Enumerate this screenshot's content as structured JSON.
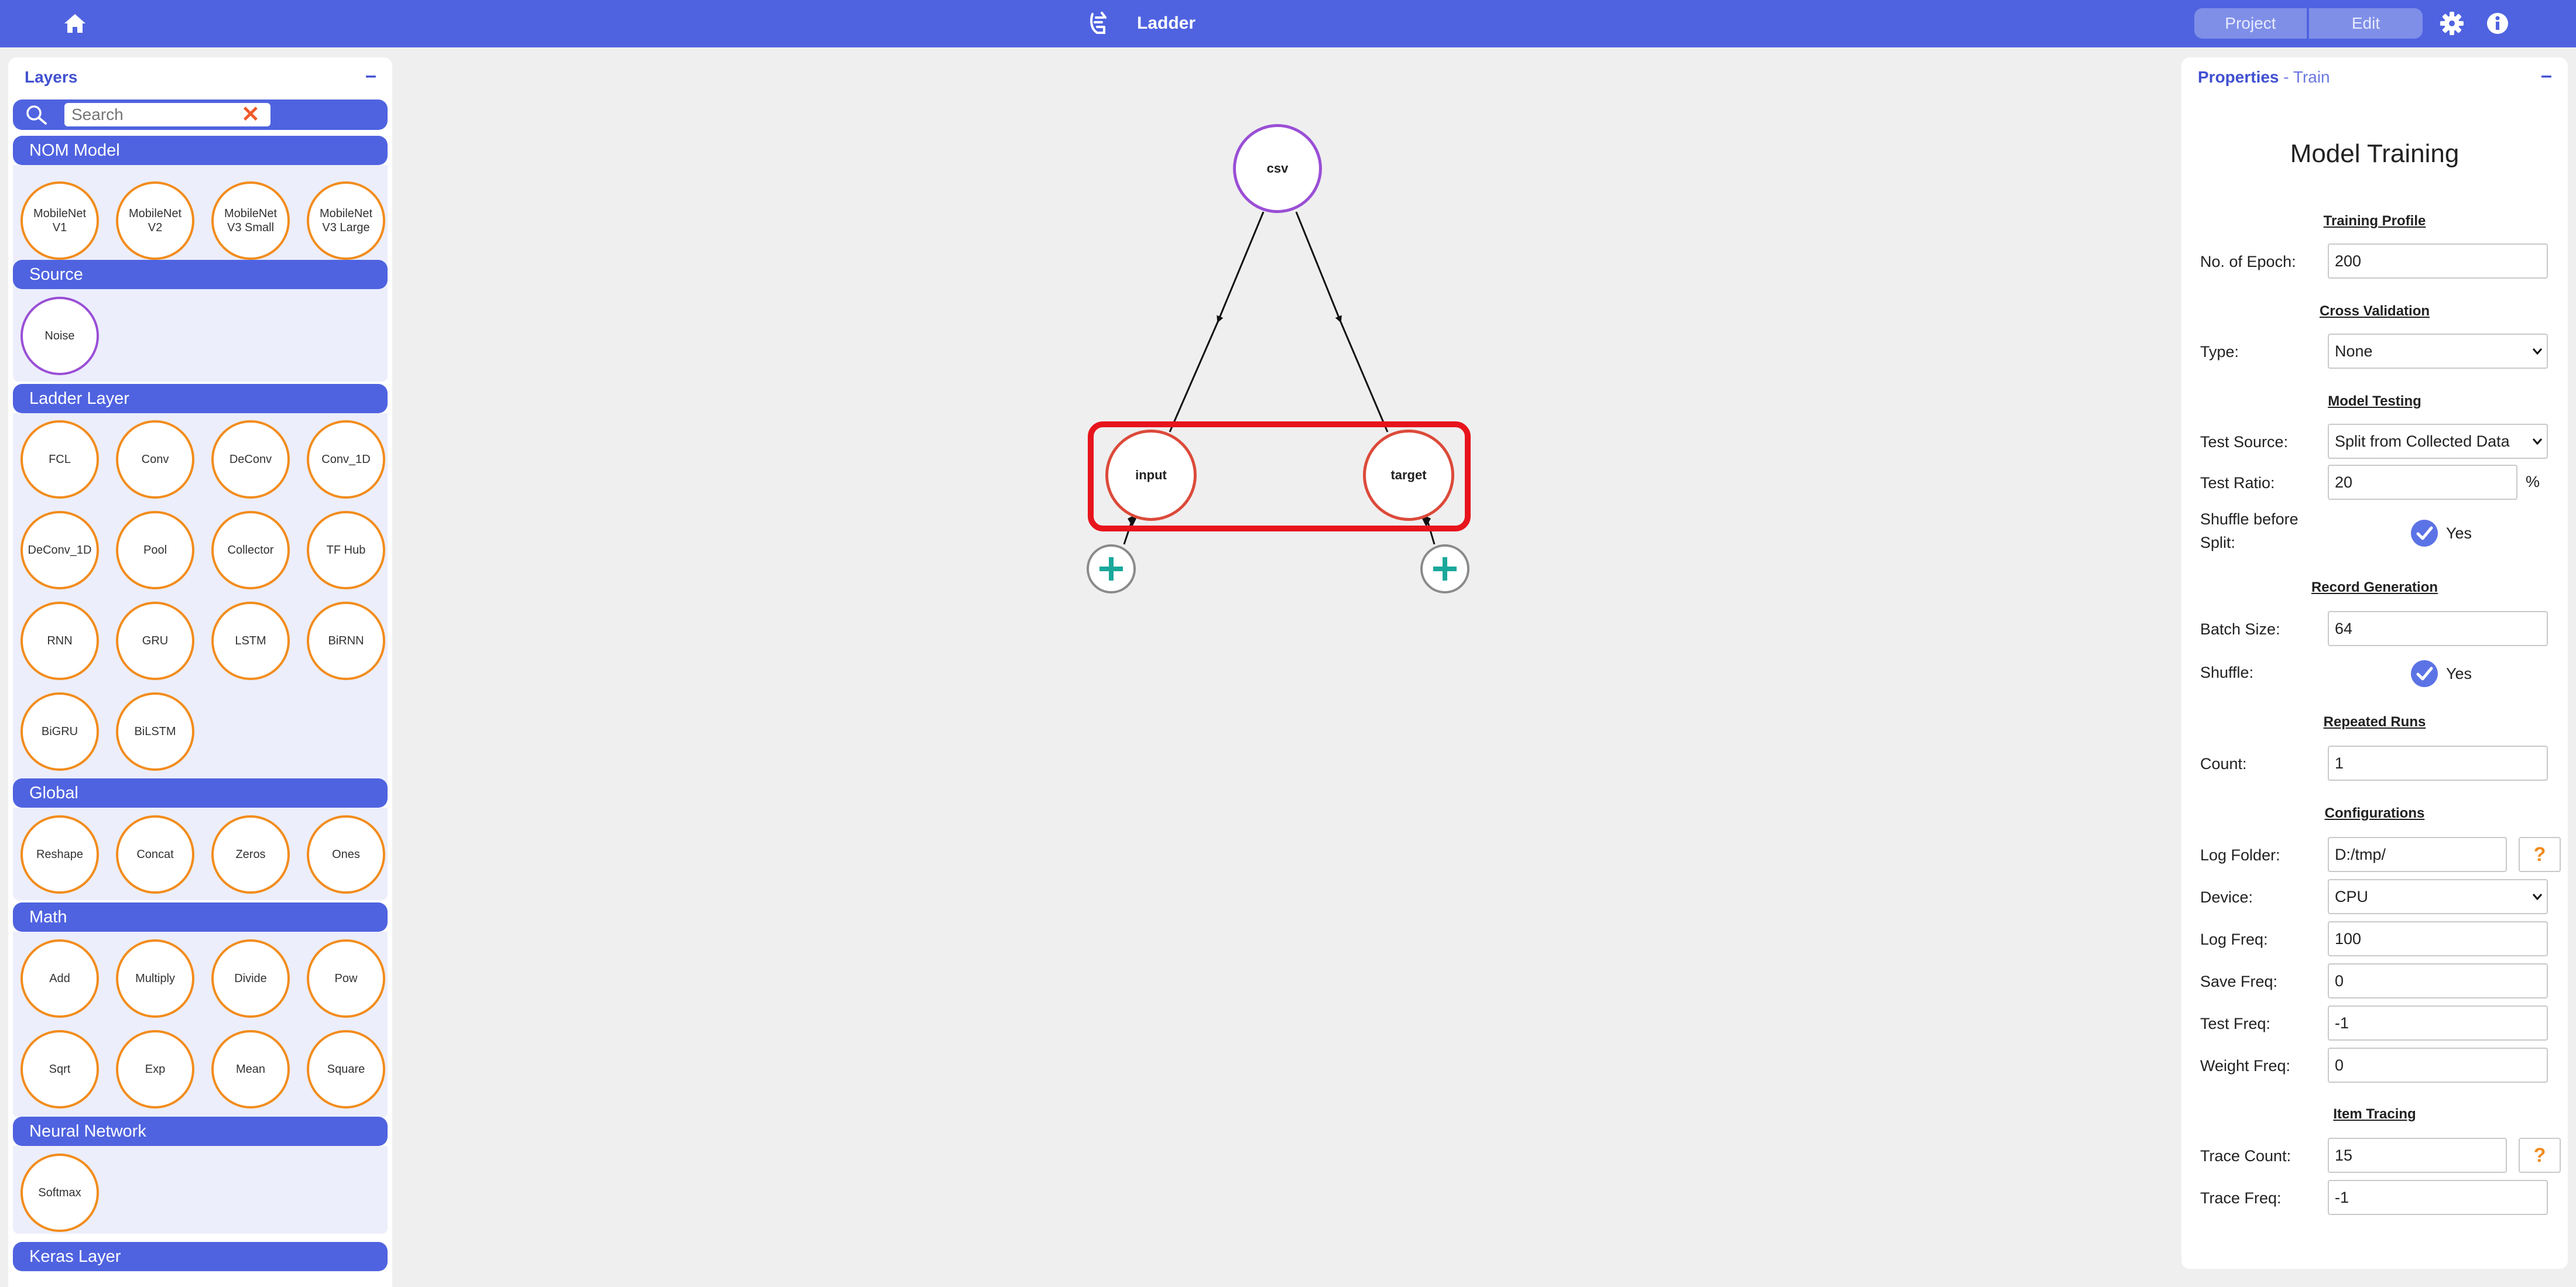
{
  "topbar": {
    "title": "Ladder",
    "project_label": "Project",
    "edit_label": "Edit"
  },
  "layers_panel": {
    "title": "Layers",
    "collapse": "–",
    "search": {
      "placeholder": "Search",
      "value": ""
    },
    "clear": "✕",
    "categories": [
      {
        "name": "NOM Model",
        "items": [
          "MobileNet V1",
          "MobileNet V2",
          "MobileNet V3 Small",
          "MobileNet V3 Large"
        ]
      },
      {
        "name": "Source",
        "items": [
          "Noise"
        ]
      },
      {
        "name": "Ladder Layer",
        "items": [
          "FCL",
          "Conv",
          "DeConv",
          "Conv_1D",
          "DeConv_1D",
          "Pool",
          "Collector",
          "TF Hub",
          "RNN",
          "GRU",
          "LSTM",
          "BiRNN",
          "BiGRU",
          "BiLSTM"
        ]
      },
      {
        "name": "Global",
        "items": [
          "Reshape",
          "Concat",
          "Zeros",
          "Ones"
        ]
      },
      {
        "name": "Math",
        "items": [
          "Add",
          "Multiply",
          "Divide",
          "Pow",
          "Sqrt",
          "Exp",
          "Mean",
          "Square"
        ]
      },
      {
        "name": "Neural Network",
        "items": [
          "Softmax"
        ]
      },
      {
        "name": "Keras Layer",
        "items": []
      }
    ]
  },
  "graph": {
    "nodes": {
      "csv": "csv",
      "input": "input",
      "target": "target"
    }
  },
  "properties": {
    "title": "Properties",
    "subtitle": " - Train",
    "collapse": "–",
    "heading": "Model Training",
    "sections": {
      "training_profile": "Training Profile",
      "cross_validation": "Cross Validation",
      "model_testing": "Model Testing",
      "record_generation": "Record Generation",
      "repeated_runs": "Repeated Runs",
      "configurations": "Configurations",
      "item_tracing": "Item Tracing"
    },
    "fields": {
      "epoch": {
        "label": "No. of Epoch:",
        "value": "200"
      },
      "cv_type": {
        "label": "Type:",
        "value": "None"
      },
      "test_source": {
        "label": "Test Source:",
        "value": "Split from Collected Data"
      },
      "test_ratio": {
        "label": "Test Ratio:",
        "value": "20",
        "unit": "%"
      },
      "shuffle_split": {
        "label_line1": "Shuffle before",
        "label_line2": "Split:",
        "checked": true,
        "text": "Yes"
      },
      "batch_size": {
        "label": "Batch Size:",
        "value": "64"
      },
      "shuffle": {
        "label": "Shuffle:",
        "checked": true,
        "text": "Yes"
      },
      "count": {
        "label": "Count:",
        "value": "1"
      },
      "log_folder": {
        "label": "Log Folder:",
        "value": "D:/tmp/"
      },
      "device": {
        "label": "Device:",
        "value": "CPU"
      },
      "log_freq": {
        "label": "Log Freq:",
        "value": "100"
      },
      "save_freq": {
        "label": "Save Freq:",
        "value": "0"
      },
      "test_freq": {
        "label": "Test Freq:",
        "value": "-1"
      },
      "weight_freq": {
        "label": "Weight Freq:",
        "value": "0"
      },
      "trace_count": {
        "label": "Trace Count:",
        "value": "15"
      },
      "trace_freq": {
        "label": "Trace Freq:",
        "value": "-1"
      }
    },
    "help_label": "?"
  },
  "colors": {
    "accent": "#4f63e0",
    "layer_border": "#f28c1c",
    "source_border": "#9a4fd6",
    "selection": "#e8141c"
  }
}
